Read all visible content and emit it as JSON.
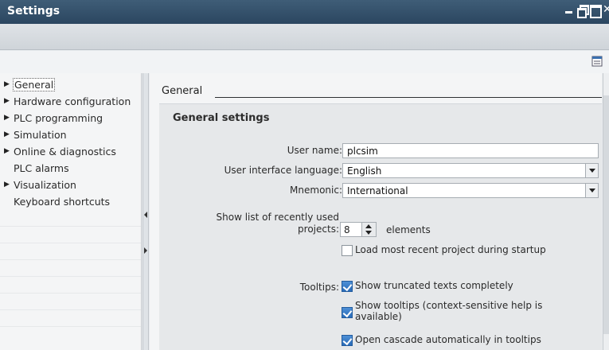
{
  "window": {
    "title": "Settings"
  },
  "sidebar": {
    "items": [
      {
        "label": "General",
        "expandable": true,
        "selected": true
      },
      {
        "label": "Hardware configuration",
        "expandable": true
      },
      {
        "label": "PLC programming",
        "expandable": true
      },
      {
        "label": "Simulation",
        "expandable": true
      },
      {
        "label": "Online & diagnostics",
        "expandable": true
      },
      {
        "label": "PLC alarms",
        "expandable": false
      },
      {
        "label": "Visualization",
        "expandable": true
      },
      {
        "label": "Keyboard shortcuts",
        "expandable": false
      }
    ]
  },
  "main": {
    "section_header": "General",
    "panel_title": "General settings",
    "user_name": {
      "label": "User name:",
      "value": "plcsim"
    },
    "ui_language": {
      "label": "User interface language:",
      "value": "English"
    },
    "mnemonic": {
      "label": "Mnemonic:",
      "value": "International"
    },
    "recent_projects": {
      "label_line1": "Show list of recently used",
      "label_line2": "projects:",
      "value": "8",
      "unit": "elements",
      "load_recent_label": "Load most recent project during startup",
      "load_recent_checked": false
    },
    "tooltips": {
      "label": "Tooltips:",
      "show_truncated": {
        "label": "Show truncated texts completely",
        "checked": true
      },
      "show_tooltips": {
        "label_line1": "Show tooltips (context-sensitive help is",
        "label_line2": "available)",
        "checked": true
      },
      "open_cascade": {
        "label": "Open cascade automatically in tooltips",
        "checked": true
      }
    }
  },
  "colors": {
    "titlebar": "#2f4b64",
    "checkbox_checked": "#2a6bb8"
  }
}
